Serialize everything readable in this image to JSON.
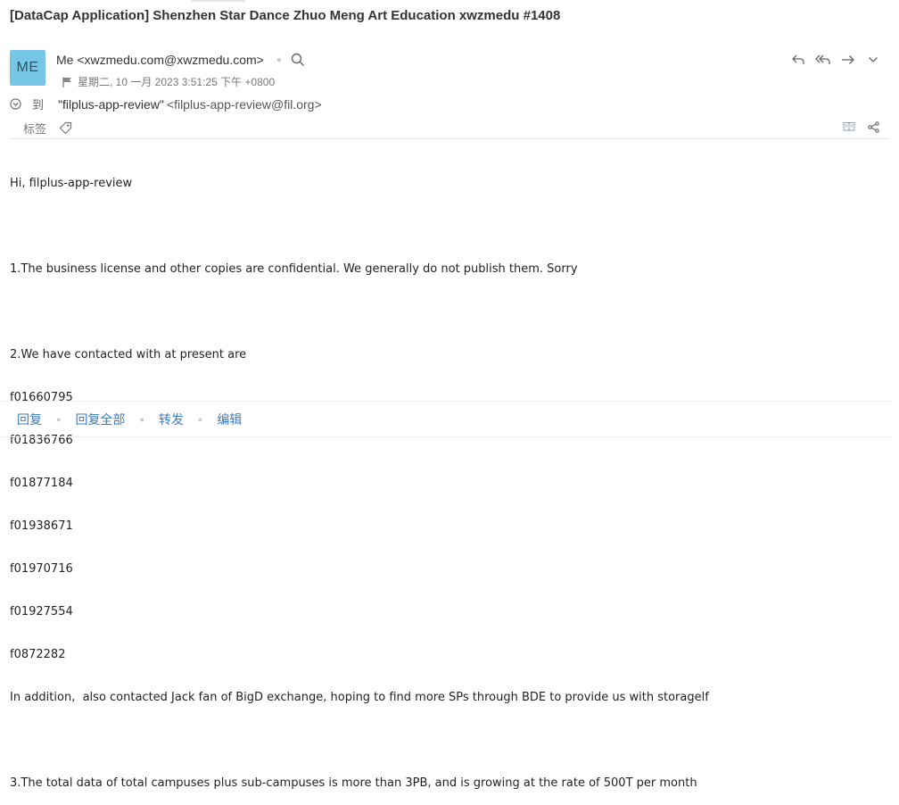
{
  "email": {
    "subject": "[DataCap Application] Shenzhen Star Dance Zhuo Meng Art Education xwzmedu #1408",
    "avatar_initials": "ME",
    "from": "Me <xwzmedu.com@xwzmedu.com>",
    "date": "星期二, 10 一月 2023 3:51:25 下午 +0800",
    "to_label": "到",
    "to_name": "\"filplus-app-review\"",
    "to_address": "<filplus-app-review@fil.org>",
    "tags_label": "标签",
    "body": {
      "greeting": "Hi, filplus-app-review",
      "p1": "1.The business license and other copies are confidential. We generally do not publish them. Sorry",
      "p2_intro": "2.We have contacted with at present are",
      "providers": [
        "f01660795",
        "f01836766",
        "f01877184",
        "f01938671",
        "f01970716",
        "f01927554",
        "f0872282"
      ],
      "p2_extra": "In addition,  also contacted Jack fan of BigD exchange, hoping to find more SPs through BDE to provide us with storagelf",
      "p3": "3.The total data of total campuses plus sub-campuses is more than 3PB, and is growing at the rate of 500T per month"
    }
  },
  "footer": {
    "reply": "回复",
    "reply_all": "回复全部",
    "forward": "转发",
    "edit": "编辑"
  },
  "icons": {
    "reply": "reply-icon",
    "reply_all": "reply-all-icon",
    "forward": "forward-icon",
    "more": "chevron-down-icon",
    "search": "search-icon",
    "flag": "flag-icon",
    "expand": "chevron-down-circle-icon",
    "tag": "tag-icon",
    "reader": "book-icon",
    "share": "share-icon"
  },
  "colors": {
    "avatar_bg": "#76c6e6",
    "link": "#3a7bbf"
  }
}
